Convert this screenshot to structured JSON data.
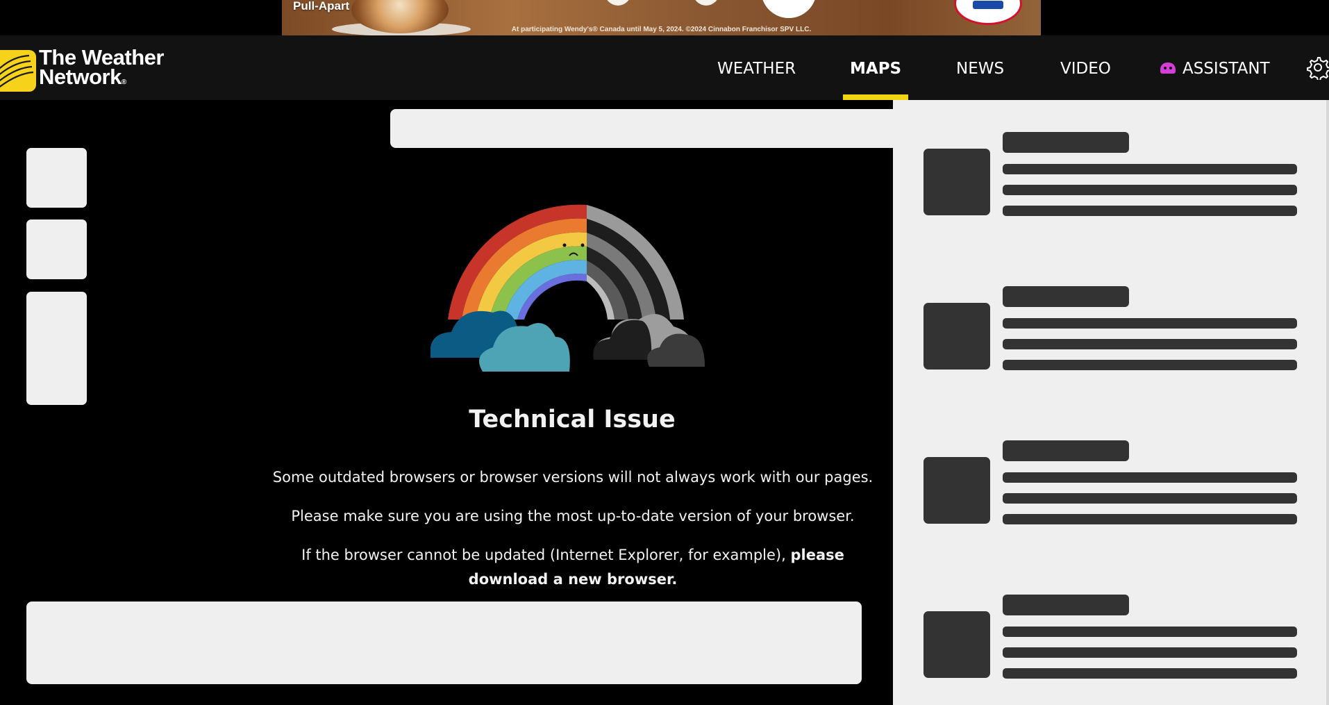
{
  "ad": {
    "headline": "Pull-Apart",
    "fineprint": "At participating Wendy's® Canada until May 5, 2024. ©2024 Cinnabon Franchisor SPV LLC."
  },
  "brand": {
    "line1": "The Weather",
    "line2": "Network",
    "reg": "®",
    "accent_color": "#f2d413"
  },
  "nav": {
    "items": [
      {
        "label": "WEATHER"
      },
      {
        "label": "MAPS"
      },
      {
        "label": "NEWS"
      },
      {
        "label": "VIDEO"
      },
      {
        "label": "ASSISTANT"
      }
    ],
    "active": "MAPS",
    "icons": [
      "assistant-robot-icon",
      "gear-icon"
    ]
  },
  "error": {
    "title": "Technical Issue",
    "line1": "Some outdated browsers or browser versions will not always work with our pages.",
    "line2": "Please make sure you are using the most up-to-date version of your browser.",
    "line3_prefix": "If the browser cannot be updated (Internet Explorer, for example),",
    "line3_bold": "please download a new browser."
  },
  "colors": {
    "page_bg": "#000000",
    "nav_bg": "#121212",
    "placeholder": "#efefef",
    "skeleton": "#333333"
  }
}
